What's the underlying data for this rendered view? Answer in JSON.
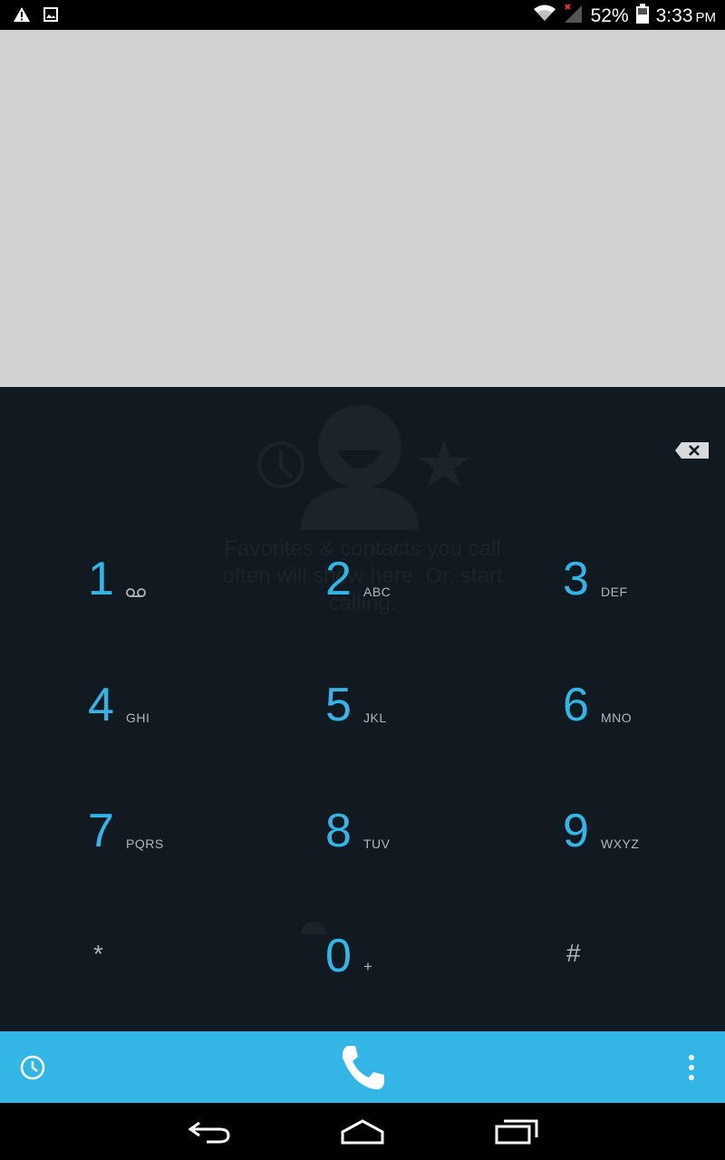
{
  "status_bar": {
    "battery_percent": "52%",
    "time": "3:33",
    "ampm": "PM",
    "icons": [
      "warning-icon",
      "image-icon",
      "wifi-icon",
      "signal-icon",
      "battery-icon"
    ]
  },
  "empty_state": {
    "text": "Favorites & contacts you call often will show here. Or, start calling."
  },
  "dialpad": {
    "keys": [
      {
        "digit": "1",
        "letters": ""
      },
      {
        "digit": "2",
        "letters": "ABC"
      },
      {
        "digit": "3",
        "letters": "DEF"
      },
      {
        "digit": "4",
        "letters": "GHI"
      },
      {
        "digit": "5",
        "letters": "JKL"
      },
      {
        "digit": "6",
        "letters": "MNO"
      },
      {
        "digit": "7",
        "letters": "PQRS"
      },
      {
        "digit": "8",
        "letters": "TUV"
      },
      {
        "digit": "9",
        "letters": "WXYZ"
      },
      {
        "digit": "*",
        "letters": ""
      },
      {
        "digit": "0",
        "letters": "+"
      },
      {
        "digit": "#",
        "letters": ""
      }
    ]
  },
  "colors": {
    "accent": "#33b5e5",
    "dial_background": "#111a21",
    "top_area": "#d2d2d2"
  }
}
